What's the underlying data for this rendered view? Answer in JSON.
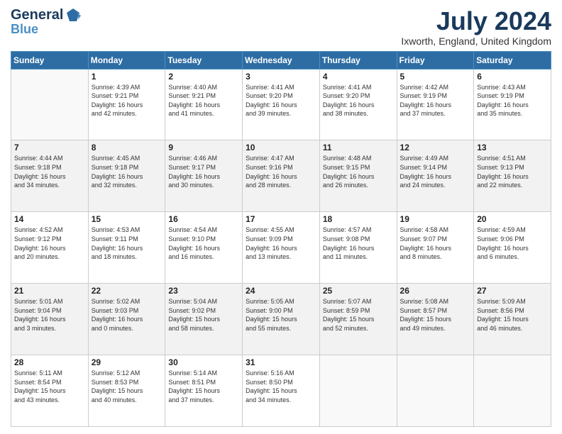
{
  "header": {
    "logo_general": "General",
    "logo_blue": "Blue",
    "month_title": "July 2024",
    "location": "Ixworth, England, United Kingdom"
  },
  "days_of_week": [
    "Sunday",
    "Monday",
    "Tuesday",
    "Wednesday",
    "Thursday",
    "Friday",
    "Saturday"
  ],
  "weeks": [
    [
      {
        "day": "",
        "info": ""
      },
      {
        "day": "1",
        "info": "Sunrise: 4:39 AM\nSunset: 9:21 PM\nDaylight: 16 hours\nand 42 minutes."
      },
      {
        "day": "2",
        "info": "Sunrise: 4:40 AM\nSunset: 9:21 PM\nDaylight: 16 hours\nand 41 minutes."
      },
      {
        "day": "3",
        "info": "Sunrise: 4:41 AM\nSunset: 9:20 PM\nDaylight: 16 hours\nand 39 minutes."
      },
      {
        "day": "4",
        "info": "Sunrise: 4:41 AM\nSunset: 9:20 PM\nDaylight: 16 hours\nand 38 minutes."
      },
      {
        "day": "5",
        "info": "Sunrise: 4:42 AM\nSunset: 9:19 PM\nDaylight: 16 hours\nand 37 minutes."
      },
      {
        "day": "6",
        "info": "Sunrise: 4:43 AM\nSunset: 9:19 PM\nDaylight: 16 hours\nand 35 minutes."
      }
    ],
    [
      {
        "day": "7",
        "info": "Sunrise: 4:44 AM\nSunset: 9:18 PM\nDaylight: 16 hours\nand 34 minutes."
      },
      {
        "day": "8",
        "info": "Sunrise: 4:45 AM\nSunset: 9:18 PM\nDaylight: 16 hours\nand 32 minutes."
      },
      {
        "day": "9",
        "info": "Sunrise: 4:46 AM\nSunset: 9:17 PM\nDaylight: 16 hours\nand 30 minutes."
      },
      {
        "day": "10",
        "info": "Sunrise: 4:47 AM\nSunset: 9:16 PM\nDaylight: 16 hours\nand 28 minutes."
      },
      {
        "day": "11",
        "info": "Sunrise: 4:48 AM\nSunset: 9:15 PM\nDaylight: 16 hours\nand 26 minutes."
      },
      {
        "day": "12",
        "info": "Sunrise: 4:49 AM\nSunset: 9:14 PM\nDaylight: 16 hours\nand 24 minutes."
      },
      {
        "day": "13",
        "info": "Sunrise: 4:51 AM\nSunset: 9:13 PM\nDaylight: 16 hours\nand 22 minutes."
      }
    ],
    [
      {
        "day": "14",
        "info": "Sunrise: 4:52 AM\nSunset: 9:12 PM\nDaylight: 16 hours\nand 20 minutes."
      },
      {
        "day": "15",
        "info": "Sunrise: 4:53 AM\nSunset: 9:11 PM\nDaylight: 16 hours\nand 18 minutes."
      },
      {
        "day": "16",
        "info": "Sunrise: 4:54 AM\nSunset: 9:10 PM\nDaylight: 16 hours\nand 16 minutes."
      },
      {
        "day": "17",
        "info": "Sunrise: 4:55 AM\nSunset: 9:09 PM\nDaylight: 16 hours\nand 13 minutes."
      },
      {
        "day": "18",
        "info": "Sunrise: 4:57 AM\nSunset: 9:08 PM\nDaylight: 16 hours\nand 11 minutes."
      },
      {
        "day": "19",
        "info": "Sunrise: 4:58 AM\nSunset: 9:07 PM\nDaylight: 16 hours\nand 8 minutes."
      },
      {
        "day": "20",
        "info": "Sunrise: 4:59 AM\nSunset: 9:06 PM\nDaylight: 16 hours\nand 6 minutes."
      }
    ],
    [
      {
        "day": "21",
        "info": "Sunrise: 5:01 AM\nSunset: 9:04 PM\nDaylight: 16 hours\nand 3 minutes."
      },
      {
        "day": "22",
        "info": "Sunrise: 5:02 AM\nSunset: 9:03 PM\nDaylight: 16 hours\nand 0 minutes."
      },
      {
        "day": "23",
        "info": "Sunrise: 5:04 AM\nSunset: 9:02 PM\nDaylight: 15 hours\nand 58 minutes."
      },
      {
        "day": "24",
        "info": "Sunrise: 5:05 AM\nSunset: 9:00 PM\nDaylight: 15 hours\nand 55 minutes."
      },
      {
        "day": "25",
        "info": "Sunrise: 5:07 AM\nSunset: 8:59 PM\nDaylight: 15 hours\nand 52 minutes."
      },
      {
        "day": "26",
        "info": "Sunrise: 5:08 AM\nSunset: 8:57 PM\nDaylight: 15 hours\nand 49 minutes."
      },
      {
        "day": "27",
        "info": "Sunrise: 5:09 AM\nSunset: 8:56 PM\nDaylight: 15 hours\nand 46 minutes."
      }
    ],
    [
      {
        "day": "28",
        "info": "Sunrise: 5:11 AM\nSunset: 8:54 PM\nDaylight: 15 hours\nand 43 minutes."
      },
      {
        "day": "29",
        "info": "Sunrise: 5:12 AM\nSunset: 8:53 PM\nDaylight: 15 hours\nand 40 minutes."
      },
      {
        "day": "30",
        "info": "Sunrise: 5:14 AM\nSunset: 8:51 PM\nDaylight: 15 hours\nand 37 minutes."
      },
      {
        "day": "31",
        "info": "Sunrise: 5:16 AM\nSunset: 8:50 PM\nDaylight: 15 hours\nand 34 minutes."
      },
      {
        "day": "",
        "info": ""
      },
      {
        "day": "",
        "info": ""
      },
      {
        "day": "",
        "info": ""
      }
    ]
  ]
}
